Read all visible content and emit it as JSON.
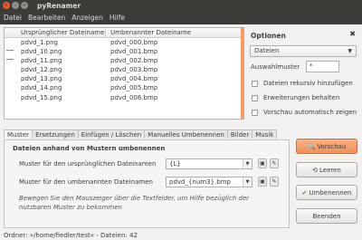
{
  "window": {
    "title": "pyRenamer",
    "buttons": {
      "close": "×",
      "minimize": "–",
      "maximize": "+"
    }
  },
  "menu": [
    "Datei",
    "Bearbeiten",
    "Anzeigen",
    "Hilfe"
  ],
  "filelist": {
    "col_original": "Ursprünglicher Dateiname",
    "col_renamed": "Umbenannter Dateiname",
    "rows": [
      {
        "original": "pdvd_1.png",
        "renamed": "pdvd_000.bmp"
      },
      {
        "original": "pdvd_10.png",
        "renamed": "pdvd_001.bmp"
      },
      {
        "original": "pdvd_11.png",
        "renamed": "pdvd_002.bmp"
      },
      {
        "original": "pdvd_12.png",
        "renamed": "pdvd_003.bmp"
      },
      {
        "original": "pdvd_13.png",
        "renamed": "pdvd_004.bmp"
      },
      {
        "original": "pdvd_14.png",
        "renamed": "pdvd_005.bmp"
      },
      {
        "original": "pdvd_15.png",
        "renamed": "pdvd_006.bmp"
      },
      {
        "original": "",
        "renamed": ""
      },
      {
        "original": "",
        "renamed": ""
      }
    ]
  },
  "options": {
    "title": "Optionen",
    "close_icon": "✖",
    "mode_value": "Dateien",
    "auswahl_label": "Auswahlmuster",
    "auswahl_value": "*",
    "recursive_label": "Dateien rekursiv hinzufügen",
    "extensions_label": "Erweiterungen behalten",
    "autopreview_label": "Vorschau automatisch zeigen"
  },
  "tabs": [
    "Muster",
    "Ersetzungen",
    "Einfügen / Löschen",
    "Manuelles Umbenennen",
    "Bilder",
    "Musik"
  ],
  "muster": {
    "heading": "Dateien anhand von Mustern umbenennen",
    "orig_label": "Muster für den ursprünglichen Dateinamen",
    "orig_value": "{L}",
    "renamed_label": "Muster für den umbenannten Dateinamen",
    "renamed_value": "pdvd_{num3}.bmp",
    "hint": "Bewegen Sie den Mauszeiger über die Textfelder, um Hilfe bezüglich der nutzbaren Muster zu bekommen"
  },
  "actions": {
    "preview": "Vorschau",
    "clear": "Leeren",
    "rename": "Umbenennen",
    "quit": "Beenden"
  },
  "status": "Ordner: »/home/fiedler/test« - Dateien: 42"
}
